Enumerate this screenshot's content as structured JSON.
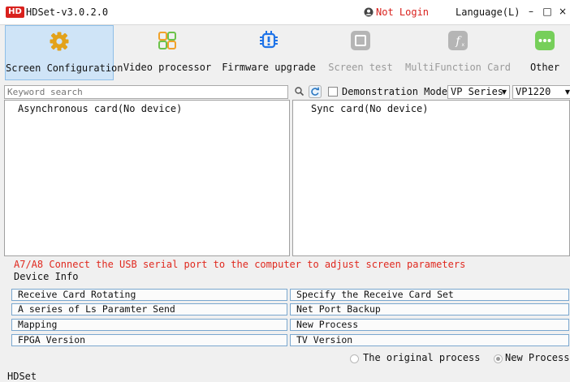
{
  "titlebar": {
    "logo_text": "HD",
    "title": "HDSet-v3.0.2.0",
    "login_status": "Not Login",
    "language_label": "Language(L)",
    "minimize": "–",
    "maximize": "□",
    "close": "×"
  },
  "toolbar": {
    "items": [
      {
        "label": "Screen Configuration",
        "icon": "gear-icon",
        "active": true
      },
      {
        "label": "Video processor",
        "icon": "video-processor-icon"
      },
      {
        "label": "Firmware upgrade",
        "icon": "chip-icon"
      },
      {
        "label": "Screen test",
        "icon": "screen-test-icon",
        "disabled": true
      },
      {
        "label": "MultiFunction Card",
        "icon": "function-icon",
        "disabled": true
      },
      {
        "label": "Other",
        "icon": "more-icon"
      }
    ]
  },
  "search": {
    "placeholder": "Keyword search",
    "demo_mode_label": "Demonstration Mode",
    "demo_mode_checked": false,
    "series_select": "VP Series",
    "model_select": "VP1220"
  },
  "panels": {
    "async_caption": "Asynchronous card(No device)",
    "sync_caption": "Sync card(No device)"
  },
  "hint_text": "A7/A8 Connect the USB serial port to the computer to adjust screen parameters",
  "device_info_label": "Device Info",
  "actions": {
    "left": [
      "Receive Card Rotating",
      "A series of Ls Paramter Send",
      "Mapping",
      "FPGA Version"
    ],
    "right": [
      "Specify the Receive Card Set",
      "Net Port Backup",
      "New Process",
      "TV Version"
    ]
  },
  "process": {
    "original_label": "The original process",
    "new_label": "New Process",
    "selected": "new"
  },
  "status_bar": "HDSet",
  "colors": {
    "accent_red": "#d9211d",
    "active_tab_bg": "#cfe4f7",
    "gear_orange": "#e3a21a",
    "video_orange": "#f0a22a",
    "video_green": "#6cc24a",
    "chip_blue": "#1e73e8",
    "disabled_gray": "#b5b5b5",
    "other_green": "#76cf5a"
  }
}
